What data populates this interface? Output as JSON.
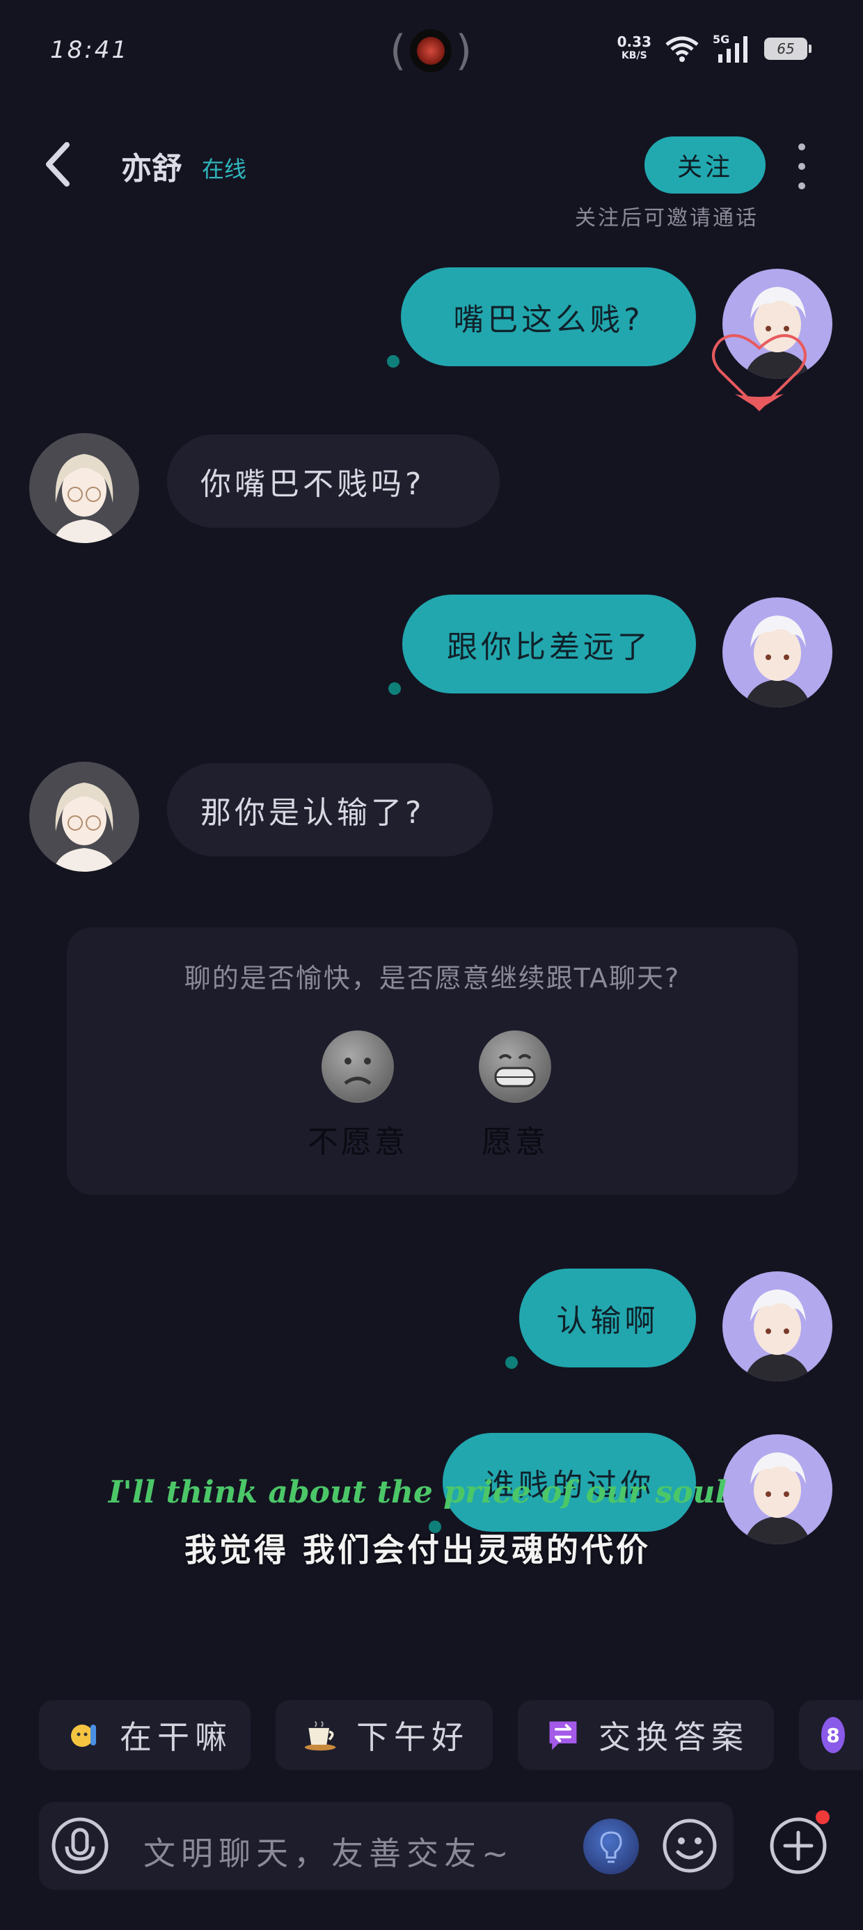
{
  "status_bar": {
    "time": "18:41",
    "speed_value": "0.33",
    "speed_unit": "KB/S",
    "network": "5G",
    "battery": "65"
  },
  "header": {
    "name": "亦舒",
    "status": "在线",
    "follow_label": "关注",
    "follow_hint": "关注后可邀请通话"
  },
  "messages": [
    {
      "side": "out",
      "text": "嘴巴这么贱?"
    },
    {
      "side": "in",
      "text": "你嘴巴不贱吗?"
    },
    {
      "side": "out",
      "text": "跟你比差远了"
    },
    {
      "side": "in",
      "text": "那你是认输了?"
    },
    {
      "side": "out",
      "text": "认输啊"
    },
    {
      "side": "out",
      "text": "谁贱的过你"
    }
  ],
  "survey": {
    "question": "聊的是否愉快，是否愿意继续跟TA聊天?",
    "options": [
      "不愿意",
      "愿意"
    ]
  },
  "lyric": {
    "en": "I'll think about the price of our soul",
    "zh": "我觉得 我们会付出灵魂的代价"
  },
  "quick_replies": [
    {
      "icon": "waving-emoji-icon",
      "label": "在干嘛"
    },
    {
      "icon": "coffee-icon",
      "label": "下午好"
    },
    {
      "icon": "exchange-icon",
      "label": "交换答案"
    },
    {
      "icon": "badge-icon",
      "label": "8"
    }
  ],
  "input": {
    "placeholder": "文明聊天，友善交友~"
  },
  "colors": {
    "background": "#141421",
    "accent": "#22a7ae",
    "bubble_in": "#1f1f2e",
    "lyric_en": "#4cc768"
  }
}
